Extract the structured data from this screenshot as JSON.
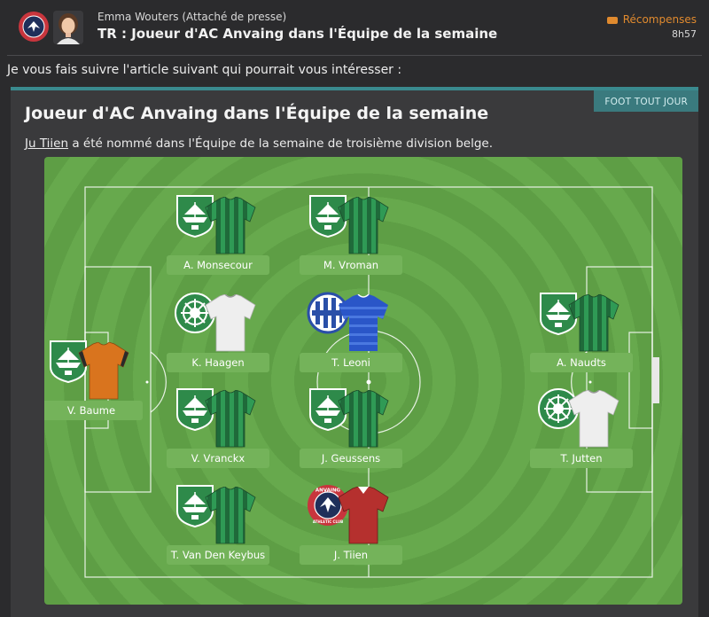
{
  "header": {
    "sender": "Emma Wouters",
    "sender_role": "(Attaché de presse)",
    "subject": "TR : Joueur d'AC Anvaing dans l'Équipe de la semaine",
    "rewards_label": "Récompenses",
    "time": "8h57"
  },
  "intro": "Je vous fais suivre l'article suivant qui pourrait vous intéresser :",
  "article": {
    "source": "FOOT TOUT JOUR",
    "headline": "Joueur d'AC Anvaing dans l'Équipe de la semaine",
    "summary_name": "Ju Tiien",
    "summary_rest": " a été nommé dans l'Équipe de la semaine de troisième division belge."
  },
  "badge_text": {
    "club_top": "ANVAING",
    "club_bottom": "ATHLETIC CLUB"
  },
  "players": [
    {
      "name": "A. Monsecour",
      "club": "green-ship",
      "kit": "green-stripes"
    },
    {
      "name": "M. Vroman",
      "club": "green-ship",
      "kit": "green-stripes"
    },
    {
      "name": "K. Haagen",
      "club": "green-wheel",
      "kit": "white"
    },
    {
      "name": "T. Leoni",
      "club": "blue-stripes",
      "kit": "blue-hoops"
    },
    {
      "name": "A. Naudts",
      "club": "green-ship",
      "kit": "green-stripes"
    },
    {
      "name": "V. Baume",
      "club": "green-ship",
      "kit": "orange"
    },
    {
      "name": "V. Vranckx",
      "club": "green-ship",
      "kit": "green-stripes"
    },
    {
      "name": "J. Geussens",
      "club": "green-ship",
      "kit": "green-stripes"
    },
    {
      "name": "T. Jutten",
      "club": "green-wheel",
      "kit": "white"
    },
    {
      "name": "T. Van Den Keybus",
      "club": "green-ship",
      "kit": "green-stripes"
    },
    {
      "name": "J. Tiien",
      "club": "anvaing",
      "kit": "red"
    }
  ],
  "colors": {
    "accent": "#3a8a8e",
    "rewards": "#e08a2e",
    "pitch_light": "#67a94d",
    "pitch_dark": "#5e9e45",
    "label_bg": "#74b35a"
  }
}
